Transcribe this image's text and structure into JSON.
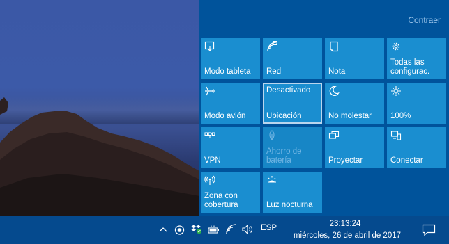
{
  "action_center": {
    "collapse_label": "Contraer",
    "tiles": [
      {
        "label": "Modo tableta",
        "icon": "tablet-mode-icon"
      },
      {
        "label": "Red",
        "icon": "network-icon"
      },
      {
        "label": "Nota",
        "icon": "note-icon"
      },
      {
        "label": "Todas las configurac.",
        "icon": "settings-gear-icon"
      },
      {
        "label": "Modo avión",
        "icon": "airplane-icon"
      },
      {
        "label": "Ubicación",
        "status": "Desactivado",
        "icon": "location-icon"
      },
      {
        "label": "No molestar",
        "icon": "quiet-hours-moon-icon"
      },
      {
        "label": "100%",
        "icon": "brightness-icon"
      },
      {
        "label": "VPN",
        "icon": "vpn-icon"
      },
      {
        "label": "Ahorro de batería",
        "icon": "battery-saver-icon"
      },
      {
        "label": "Proyectar",
        "icon": "project-icon"
      },
      {
        "label": "Conectar",
        "icon": "connect-icon"
      },
      {
        "label": "Zona con cobertura",
        "icon": "mobile-hotspot-icon"
      },
      {
        "label": "Luz nocturna",
        "icon": "night-light-icon"
      }
    ]
  },
  "taskbar": {
    "language": "ESP",
    "time": "23:13:24",
    "date": "miércoles, 26 de abril de 2017",
    "tray_icons": [
      "chevron-up-icon",
      "record-icon",
      "dropbox-icon",
      "battery-icon",
      "wifi-icon",
      "volume-icon"
    ],
    "notification_icon": "action-center-notification-icon"
  },
  "colors": {
    "panel": "#00539b",
    "tile": "#1a8ed0",
    "taskbar": "#054a8e",
    "link": "#9fc7ec"
  }
}
